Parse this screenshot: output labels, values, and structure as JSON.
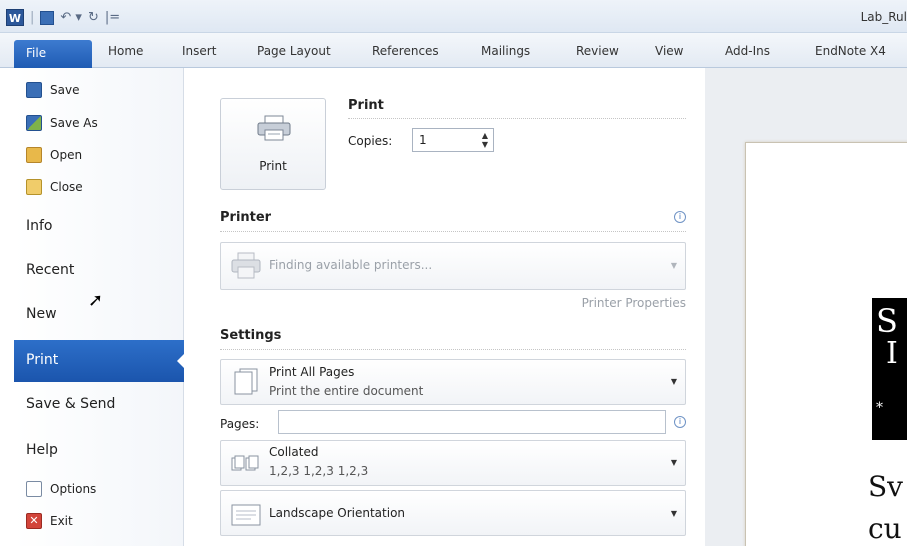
{
  "window": {
    "title": "Lab_Rul"
  },
  "qat": {
    "app_icon": "W",
    "separator": "|",
    "undo_icon": "↶ ▾",
    "redo_icon": "↻",
    "customize": "|="
  },
  "ribbon": {
    "file_tab": "File",
    "tabs": [
      "Home",
      "Insert",
      "Page Layout",
      "References",
      "Mailings",
      "Review",
      "View",
      "Add-Ins",
      "EndNote X4"
    ]
  },
  "backstage": {
    "small_items": {
      "save": "Save",
      "save_as": "Save As",
      "open": "Open",
      "close": "Close"
    },
    "info": "Info",
    "recent": "Recent",
    "new": "New",
    "print": "Print",
    "save_send": "Save & Send",
    "help": "Help",
    "options": "Options",
    "exit": "Exit"
  },
  "print_panel": {
    "button_label": "Print",
    "heading": "Print",
    "copies_label": "Copies:",
    "copies_value": "1",
    "printer_heading": "Printer",
    "printer_status": "Finding available printers...",
    "printer_properties": "Printer Properties",
    "settings_heading": "Settings",
    "pages_setting": {
      "title": "Print All Pages",
      "subtitle": "Print the entire document"
    },
    "pages_label": "Pages:",
    "pages_value": "",
    "collate_setting": {
      "title": "Collated",
      "subtitle": "1,2,3   1,2,3   1,2,3"
    },
    "orientation_setting": {
      "title": "Landscape Orientation"
    },
    "info_glyph": "i",
    "dropdown_glyph": "▼"
  },
  "preview": {
    "banner_line1": "S",
    "banner_line2": "I",
    "banner_mark": "*",
    "text_line1": "Sv",
    "text_line2": "cu"
  },
  "colors": {
    "file_tab": "#2a64bd",
    "selected_nav": "#2466c2",
    "accent": "#3d6fb8"
  }
}
